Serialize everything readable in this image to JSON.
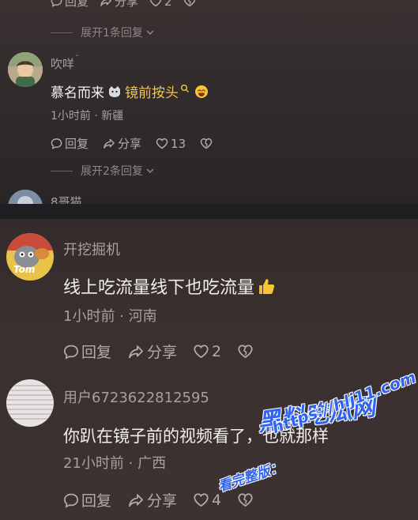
{
  "top": {
    "first_actions": {
      "reply": "回复",
      "share": "分享",
      "likes": "2"
    },
    "expand_first": "展开1条回复",
    "comment": {
      "username": "吹咩",
      "text_plain": "慕名而来",
      "text_link": "镜前按头",
      "meta": "1小时前 · 新疆",
      "reply": "回复",
      "share": "分享",
      "likes": "13"
    },
    "expand_second": "展开2条回复",
    "next_username_partial": "8哥猫"
  },
  "bottom": {
    "comments": [
      {
        "username": "开挖掘机",
        "avatar_badge": "Tom",
        "text": "线上吃流量线下也吃流量",
        "meta": "1小时前 · 河南",
        "reply": "回复",
        "share": "分享",
        "likes": "2"
      },
      {
        "username": "用户6723622812595",
        "text": "你趴在镜子前的视频看了，也就那样",
        "meta": "21小时前 · 广西",
        "reply": "回复",
        "share": "分享",
        "likes": "4"
      }
    ]
  },
  "watermark": {
    "site": "黑料吃瓜网",
    "url": "https://hlj11.com",
    "caption": "看完整版："
  },
  "colors": {
    "link": "#f5c542",
    "text": "#f2eeee",
    "muted": "#a8a09f",
    "watermark": "#2f63f0"
  }
}
